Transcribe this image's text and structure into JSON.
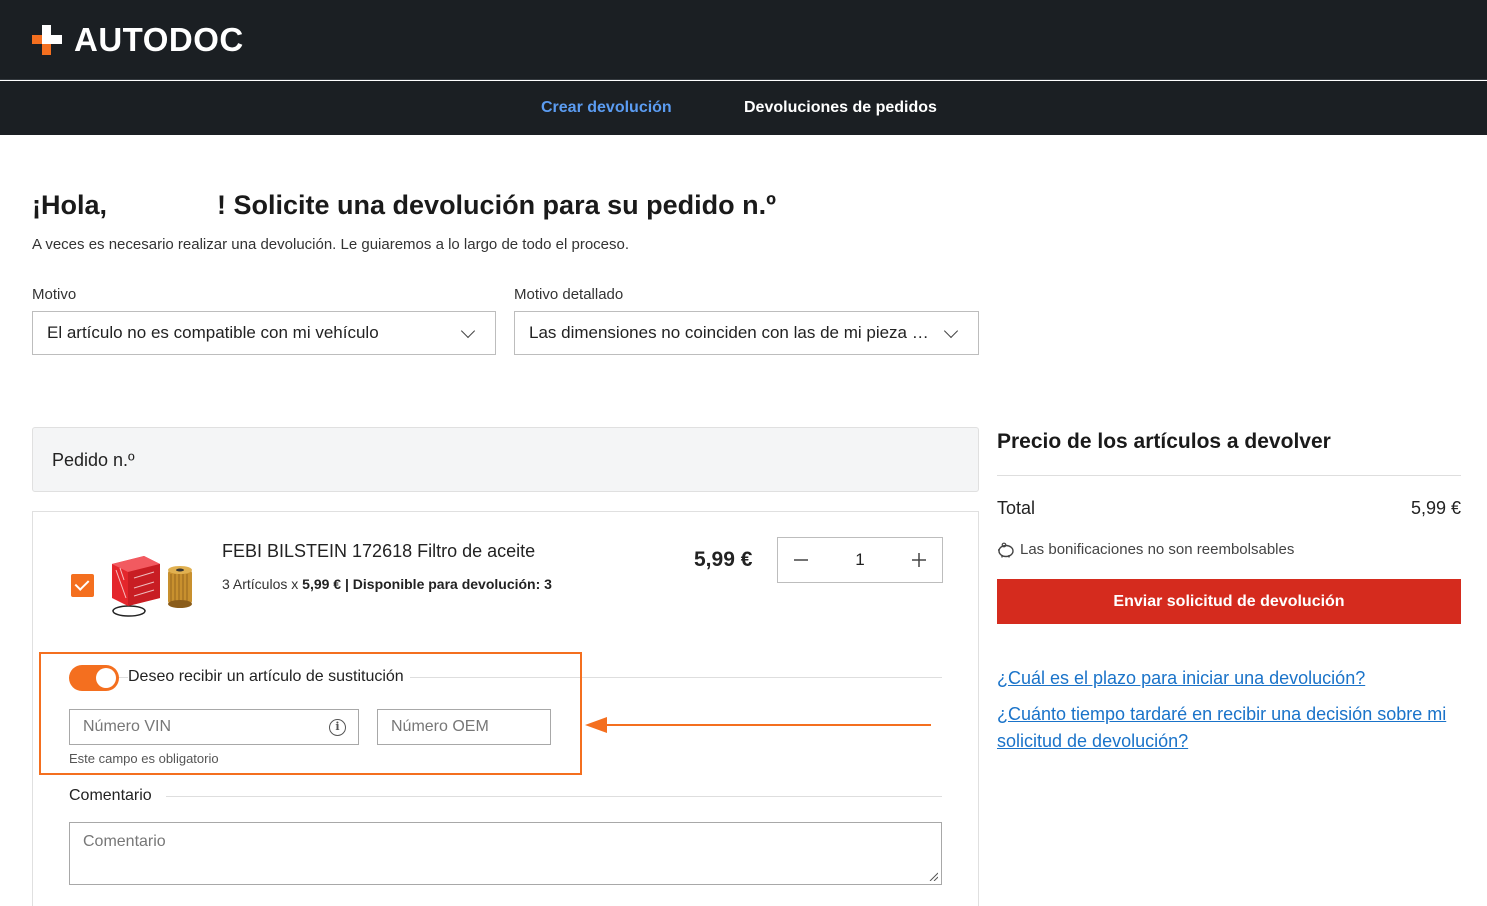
{
  "header": {
    "logo_text": "AUTODOC",
    "brand_color": "#f46f1f"
  },
  "nav": {
    "tabs": [
      {
        "label": "Crear devolución",
        "active": true
      },
      {
        "label": "Devoluciones de pedidos",
        "active": false
      }
    ]
  },
  "intro": {
    "greeting_start": "¡Hola,",
    "greeting_end": "! Solicite una devolución para su pedido n.º",
    "subtitle": "A veces es necesario realizar una devolución. Le guiaremos a lo largo de todo el proceso."
  },
  "reason": {
    "label": "Motivo",
    "value": "El artículo no es compatible con mi vehículo"
  },
  "detailed_reason": {
    "label": "Motivo detallado",
    "value": "Las dimensiones no coinciden con las de mi pieza original"
  },
  "order": {
    "header": "Pedido n.º"
  },
  "item": {
    "name": "FEBI BILSTEIN 172618 Filtro de aceite",
    "qty_text": "3 Artículos x",
    "unit_price": "5,99 €",
    "separator": "|",
    "available": "Disponible para devolución: 3",
    "price": "5,99 €",
    "quantity": "1",
    "checked": true
  },
  "replacement": {
    "toggle_label": "Deseo recibir un artículo de sustitución",
    "vin_placeholder": "Número VIN",
    "oem_placeholder": "Número OEM",
    "required_hint": "Este campo es obligatorio"
  },
  "comment": {
    "label": "Comentario",
    "placeholder": "Comentario"
  },
  "summary": {
    "title": "Precio de los artículos a devolver",
    "total_label": "Total",
    "total_value": "5,99 €",
    "bonus_note": "Las bonificaciones no son reembolsables",
    "submit_label": "Enviar solicitud de devolución"
  },
  "faq": {
    "q1": "¿Cuál es el plazo para iniciar una devolución?",
    "q2": "¿Cuánto tiempo tardaré en recibir una decisión sobre mi solicitud de devolución?"
  },
  "colors": {
    "accent_orange": "#f46f1f",
    "submit_red": "#d52b1e",
    "link_blue": "#1a73c9",
    "nav_active": "#5b9cf2",
    "header_bg": "#1b1f23"
  }
}
